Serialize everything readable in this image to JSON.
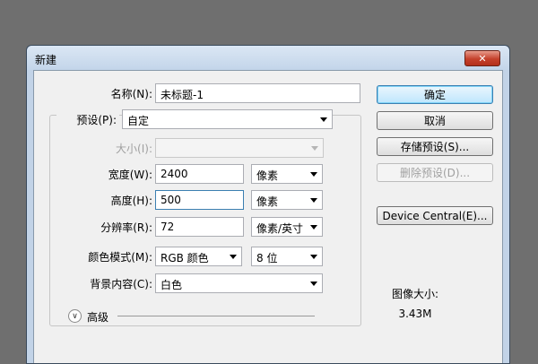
{
  "dialog": {
    "title": "新建",
    "close": "✕"
  },
  "form": {
    "name_label": "名称(N):",
    "name_value": "未标题-1",
    "preset_label": "预设(P):",
    "preset_value": "自定",
    "size_label": "大小(I):",
    "size_value": "",
    "width_label": "宽度(W):",
    "width_value": "2400",
    "width_unit": "像素",
    "height_label": "高度(H):",
    "height_value": "500",
    "height_unit": "像素",
    "resolution_label": "分辨率(R):",
    "resolution_value": "72",
    "resolution_unit": "像素/英寸",
    "color_mode_label": "颜色模式(M):",
    "color_mode_value": "RGB 颜色",
    "bit_depth_value": "8 位",
    "background_label": "背景内容(C):",
    "background_value": "白色",
    "advanced_label": "高级",
    "advanced_icon": "double-chevron-down-icon"
  },
  "buttons": {
    "ok": "确定",
    "cancel": "取消",
    "save_preset": "存储预设(S)...",
    "delete_preset": "删除预设(D)...",
    "device_central": "Device Central(E)..."
  },
  "info": {
    "image_size_label": "图像大小:",
    "image_size_value": "3.43M"
  }
}
